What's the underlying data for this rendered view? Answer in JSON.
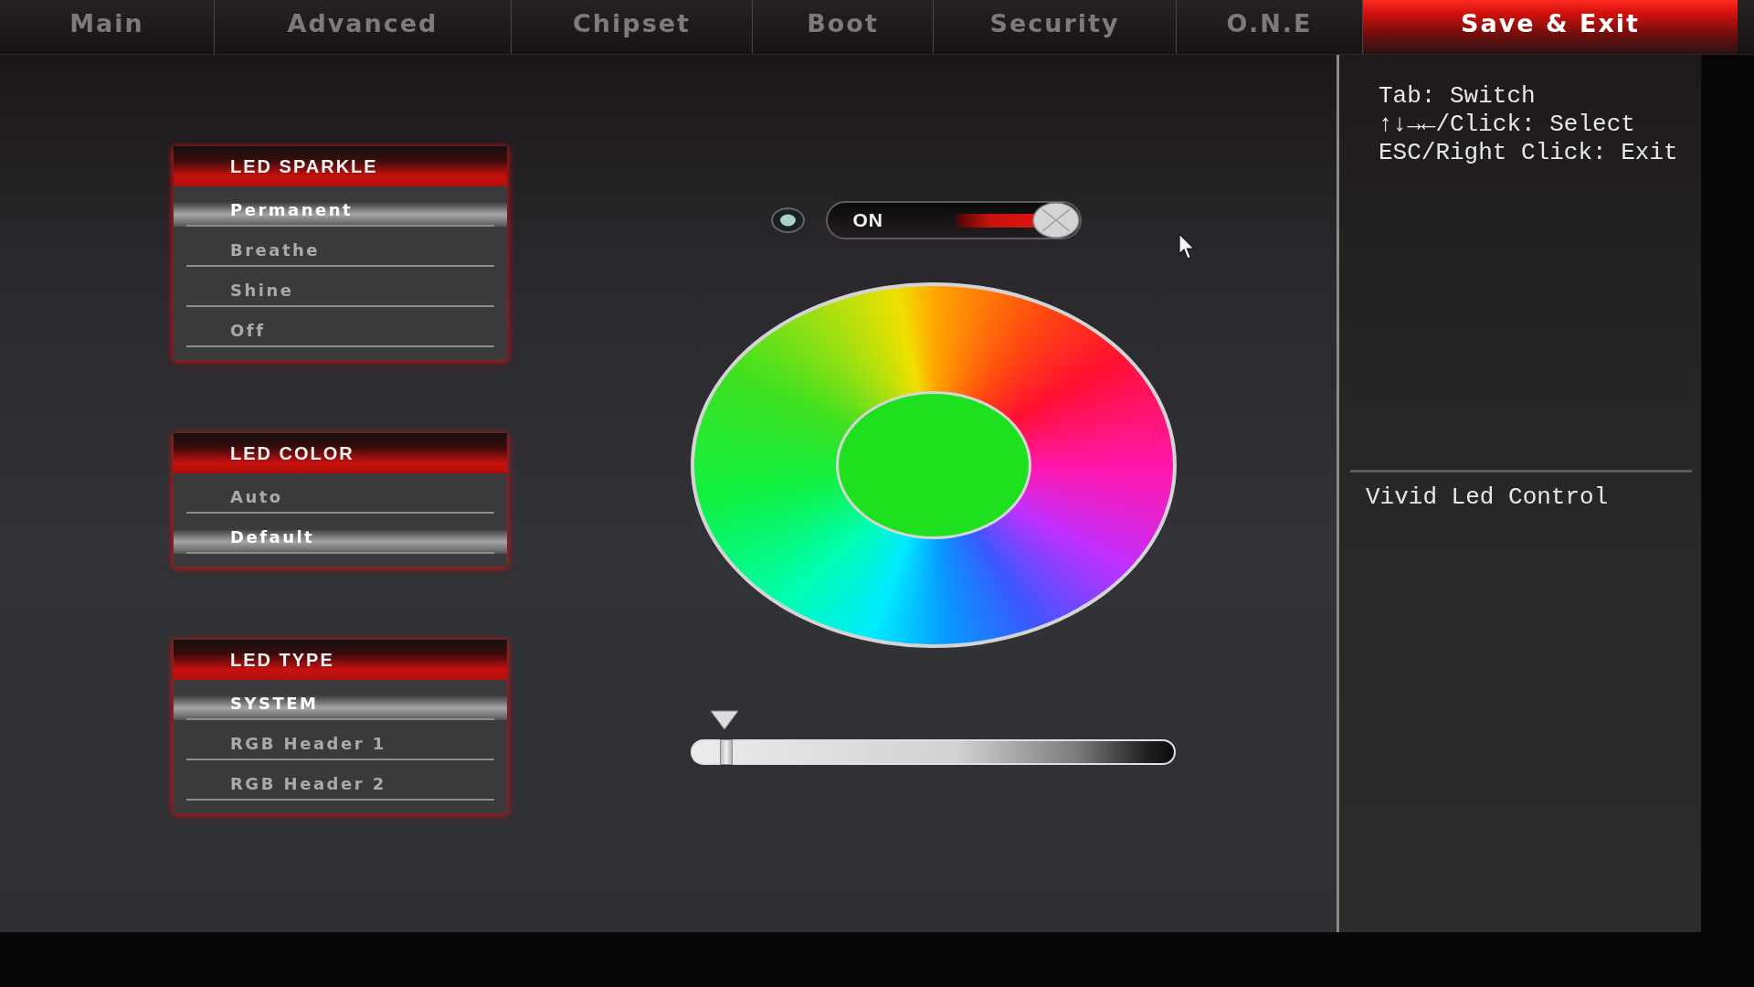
{
  "tabs": [
    {
      "label": "Main",
      "selected": false
    },
    {
      "label": "Advanced",
      "selected": false
    },
    {
      "label": "Chipset",
      "selected": false
    },
    {
      "label": "Boot",
      "selected": false
    },
    {
      "label": "Security",
      "selected": false
    },
    {
      "label": "O.N.E",
      "selected": false
    },
    {
      "label": "Save & Exit",
      "selected": true
    }
  ],
  "led_panels": [
    {
      "title": "LED SPARKLE",
      "options": [
        {
          "label": "Permanent",
          "selected": true
        },
        {
          "label": "Breathe",
          "selected": false
        },
        {
          "label": "Shine",
          "selected": false
        },
        {
          "label": "Off",
          "selected": false
        }
      ]
    },
    {
      "title": "LED COLOR",
      "options": [
        {
          "label": "Auto",
          "selected": false
        },
        {
          "label": "Default",
          "selected": true
        }
      ]
    },
    {
      "title": "LED TYPE",
      "options": [
        {
          "label": "SYSTEM",
          "selected": true
        },
        {
          "label": "RGB Header 1",
          "selected": false
        },
        {
          "label": "RGB Header 2",
          "selected": false
        }
      ]
    }
  ],
  "led_switch": {
    "label": "ON",
    "on": true
  },
  "color_picker": {
    "color": "#1fe01f"
  },
  "slider": {
    "level": 0.07
  },
  "help": {
    "lines": [
      "Tab: Switch",
      "↑↓→←/Click: Select",
      "ESC/Right Click: Exit"
    ],
    "description": "Vivid Led Control"
  }
}
